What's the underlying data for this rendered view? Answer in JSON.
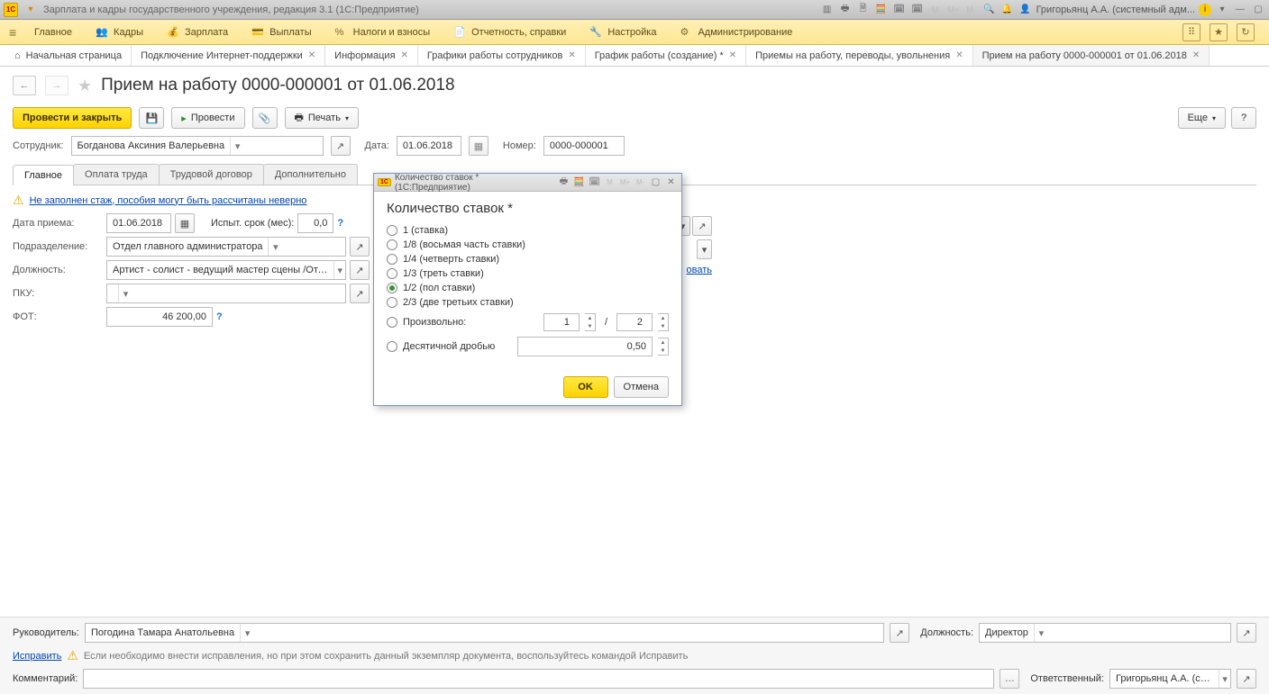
{
  "topBar": {
    "appTitle": "Зарплата и кадры государственного учреждения, редакция 3.1  (1С:Предприятие)",
    "userBadge": "Григорьянц А.А. (системный адм...",
    "thinIcons": [
      "M",
      "M+",
      "M-"
    ]
  },
  "mainMenu": {
    "items": [
      "Главное",
      "Кадры",
      "Зарплата",
      "Выплаты",
      "Налоги и взносы",
      "Отчетность, справки",
      "Настройка",
      "Администрирование"
    ]
  },
  "tabs": [
    {
      "label": "Начальная страница",
      "icon": "home",
      "closable": false
    },
    {
      "label": "Подключение Интернет-поддержки",
      "closable": true
    },
    {
      "label": "Информация",
      "closable": true
    },
    {
      "label": "Графики работы сотрудников",
      "closable": true
    },
    {
      "label": "График работы (создание) *",
      "closable": true
    },
    {
      "label": "Приемы на работу, переводы, увольнения",
      "closable": true
    },
    {
      "label": "Прием на работу 0000-000001 от 01.06.2018",
      "closable": true,
      "active": true
    }
  ],
  "page": {
    "title": "Прием на работу 0000-000001 от 01.06.2018",
    "postCloseBtn": "Провести и закрыть",
    "postBtn": "Провести",
    "printBtn": "Печать",
    "moreBtn": "Еще",
    "helpBtn": "?",
    "employeeLabel": "Сотрудник:",
    "employeeValue": "Богданова Аксиния Валерьевна",
    "dateLabel": "Дата:",
    "dateValue": "01.06.2018",
    "numberLabel": "Номер:",
    "numberValue": "0000-000001",
    "subTabs": [
      "Главное",
      "Оплата труда",
      "Трудовой договор",
      "Дополнительно"
    ],
    "warnText": "Не заполнен стаж, пособия могут быть рассчитаны неверно",
    "acceptDateLabel": "Дата приема:",
    "acceptDateValue": "01.06.2018",
    "trialLabel": "Испыт. срок (мес):",
    "trialValue": "0,0",
    "deptLabel": "Подразделение:",
    "deptValue": "Отдел главного администратора",
    "positionLabel": "Должность:",
    "positionValue": "Артист - солист - ведущий мастер сцены /Отдел главного а...",
    "pkuLabel": "ПКУ:",
    "pkuValue": "",
    "fotLabel": "ФОТ:",
    "fotValue": "46 200,00",
    "rightLinkSuffix": "овать"
  },
  "footer": {
    "managerLabel": "Руководитель:",
    "managerValue": "Погодина Тамара Анатольевна",
    "positionLabel": "Должность:",
    "positionValue": "Директор",
    "fixLink": "Исправить",
    "fixNote": "Если необходимо внести исправления, но при этом сохранить данный экземпляр документа, воспользуйтесь командой Исправить",
    "commentLabel": "Комментарий:",
    "responsibleLabel": "Ответственный:",
    "responsibleValue": "Григорьянц А.А. (системн..."
  },
  "modal": {
    "windowTitle": "Количество ставок *  (1С:Предприятие)",
    "heading": "Количество ставок *",
    "options": [
      "1 (ставка)",
      "1/8 (восьмая часть ставки)",
      "1/4 (четверть ставки)",
      "1/3 (треть ставки)",
      "1/2 (пол ставки)",
      "2/3 (две третьих ставки)"
    ],
    "selectedIndex": 4,
    "customLabel": "Произвольно:",
    "customA": "1",
    "customSep": "/",
    "customB": "2",
    "decimalLabel": "Десятичной дробью",
    "decimalValue": "0,50",
    "okBtn": "OK",
    "cancelBtn": "Отмена"
  }
}
